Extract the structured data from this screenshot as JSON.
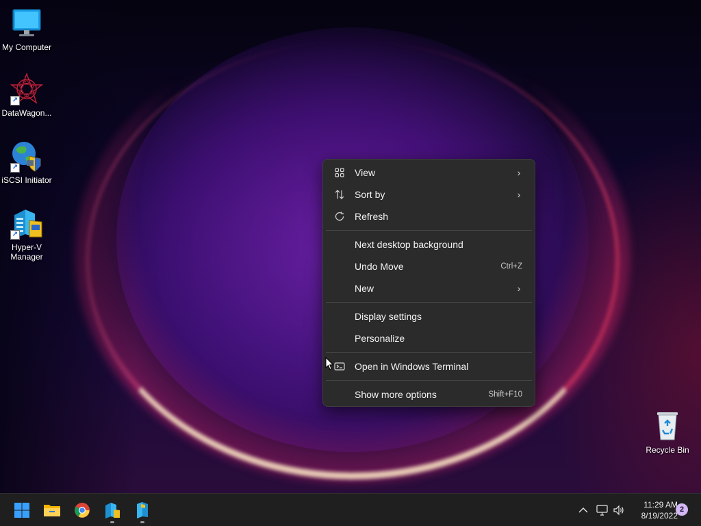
{
  "desktop": {
    "icons": [
      {
        "label": "My Computer",
        "icon": "monitor-icon"
      },
      {
        "label": "DataWagon...",
        "icon": "datawagon-icon"
      },
      {
        "label": "iSCSI Initiator",
        "icon": "iscsi-globe-icon"
      },
      {
        "label": "Hyper-V Manager",
        "icon": "hyperv-icon"
      },
      {
        "label": "Recycle Bin",
        "icon": "recycle-bin-icon"
      }
    ]
  },
  "context_menu": {
    "items": [
      {
        "label": "View",
        "icon": "grid-icon",
        "submenu": true
      },
      {
        "label": "Sort by",
        "icon": "sort-icon",
        "submenu": true
      },
      {
        "label": "Refresh",
        "icon": "refresh-icon"
      },
      {
        "label": "Next desktop background"
      },
      {
        "label": "Undo Move",
        "shortcut": "Ctrl+Z"
      },
      {
        "label": "New",
        "submenu": true
      },
      {
        "label": "Display settings"
      },
      {
        "label": "Personalize"
      },
      {
        "label": "Open in Windows Terminal",
        "icon": "terminal-icon"
      },
      {
        "label": "Show more options",
        "shortcut": "Shift+F10"
      }
    ]
  },
  "taskbar": {
    "apps": [
      {
        "name": "start-button"
      },
      {
        "name": "file-explorer"
      },
      {
        "name": "chrome"
      },
      {
        "name": "hyper-v-manager",
        "running": true
      },
      {
        "name": "hyper-v-manager-2",
        "running": true
      }
    ],
    "tray": {
      "overflow_icon": "chevron-up-icon",
      "network_icon": "network-icon",
      "volume_icon": "volume-icon"
    },
    "clock": {
      "time": "11:29 AM",
      "date": "8/19/2022"
    },
    "notification_count": "2"
  },
  "colors": {
    "menu_bg": "#2b2b2b",
    "taskbar_bg": "#1f1f1f",
    "badge": "#d3b8f5",
    "start_blue": "#3aa0ff"
  }
}
